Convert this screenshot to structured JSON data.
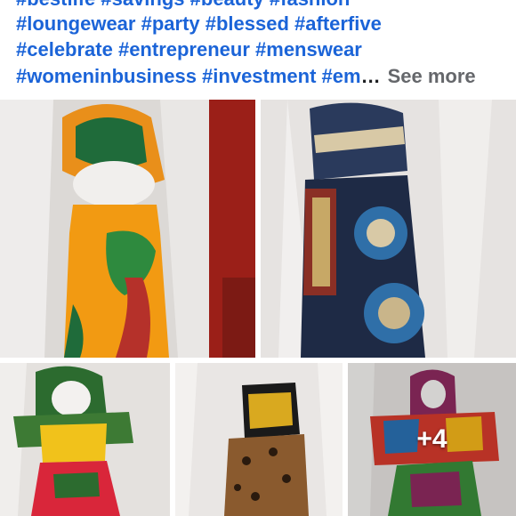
{
  "post": {
    "caption_lines": [
      "#bestlife #savings #beauty #fashion",
      "#loungewear #party #blessed #afterfive",
      "#celebrate #entrepreneur #menswear",
      "#womeninbusiness #investment #em"
    ],
    "ellipsis": "…",
    "see_more_label": "See more"
  },
  "gallery": {
    "more_count": "+4"
  },
  "colors": {
    "hashtag": "#1b64d8",
    "muted": "#65676b"
  }
}
